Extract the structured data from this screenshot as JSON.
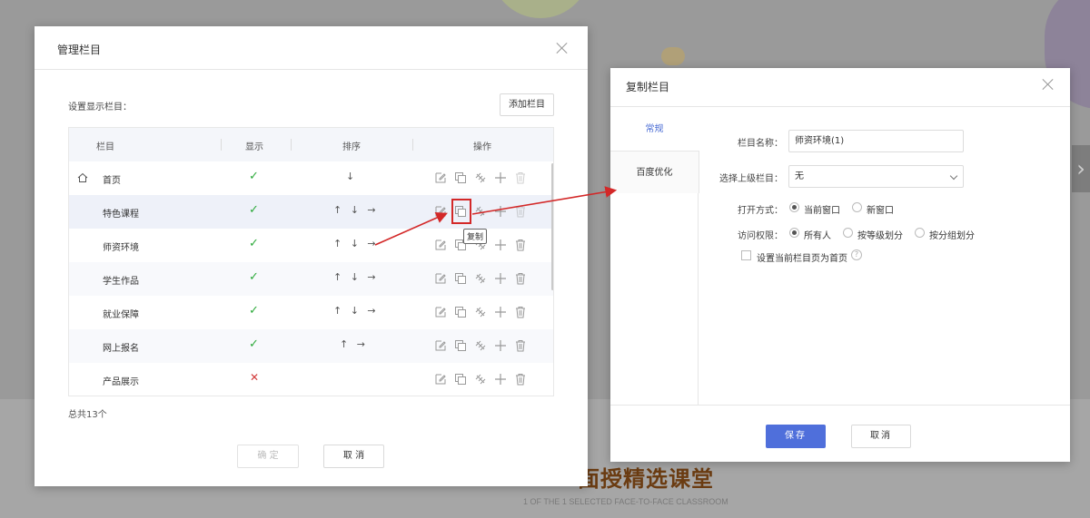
{
  "background": {
    "heading": "面授精选课堂",
    "subheading": "1 OF THE 1 SELECTED FACE-TO-FACE CLASSROOM",
    "next_arrow": "›"
  },
  "manage_dialog": {
    "title": "管理栏目",
    "setting_label": "设置显示栏目：",
    "add_button": "添加栏目",
    "columns": [
      "栏目",
      "显示",
      "排序",
      "操作"
    ],
    "rows": [
      {
        "name": "首页",
        "visible": "✓",
        "sort": "↓",
        "home": true
      },
      {
        "name": "特色课程",
        "visible": "✓",
        "sort": "↑ ↓ →"
      },
      {
        "name": "师资环境",
        "visible": "✓",
        "sort": "↑ ↓ →"
      },
      {
        "name": "学生作品",
        "visible": "✓",
        "sort": "↑ ↓ →"
      },
      {
        "name": "就业保障",
        "visible": "✓",
        "sort": "↑ ↓ →"
      },
      {
        "name": "网上报名",
        "visible": "✓",
        "sort": "↑ →"
      },
      {
        "name": "产品展示",
        "visible": "✕",
        "sort": ""
      }
    ],
    "op_icons": [
      "edit-icon",
      "copy-icon",
      "link-icon",
      "add-icon",
      "delete-icon"
    ],
    "tooltip": "复制",
    "total": "总共13个",
    "ok_button": "确 定",
    "cancel_button": "取 消"
  },
  "copy_dialog": {
    "title": "复制栏目",
    "tabs": [
      "常规",
      "百度优化"
    ],
    "name_label": "栏目名称：",
    "name_value": "师资环境(1)",
    "parent_label": "选择上级栏目：",
    "parent_value": "无",
    "open_label": "打开方式：",
    "open_options": [
      "当前窗口",
      "新窗口"
    ],
    "open_selected": "当前窗口",
    "access_label": "访问权限：",
    "access_options": [
      "所有人",
      "按等级划分",
      "按分组划分"
    ],
    "access_selected": "所有人",
    "homepage_checkbox": "设置当前栏目页为首页",
    "help_icon": "?",
    "save_button": "保存",
    "cancel_button": "取消"
  },
  "colors": {
    "accent": "#4f6fdb",
    "check": "#2eaa3c",
    "cross": "#d23b3b",
    "annotation": "#d32828"
  }
}
